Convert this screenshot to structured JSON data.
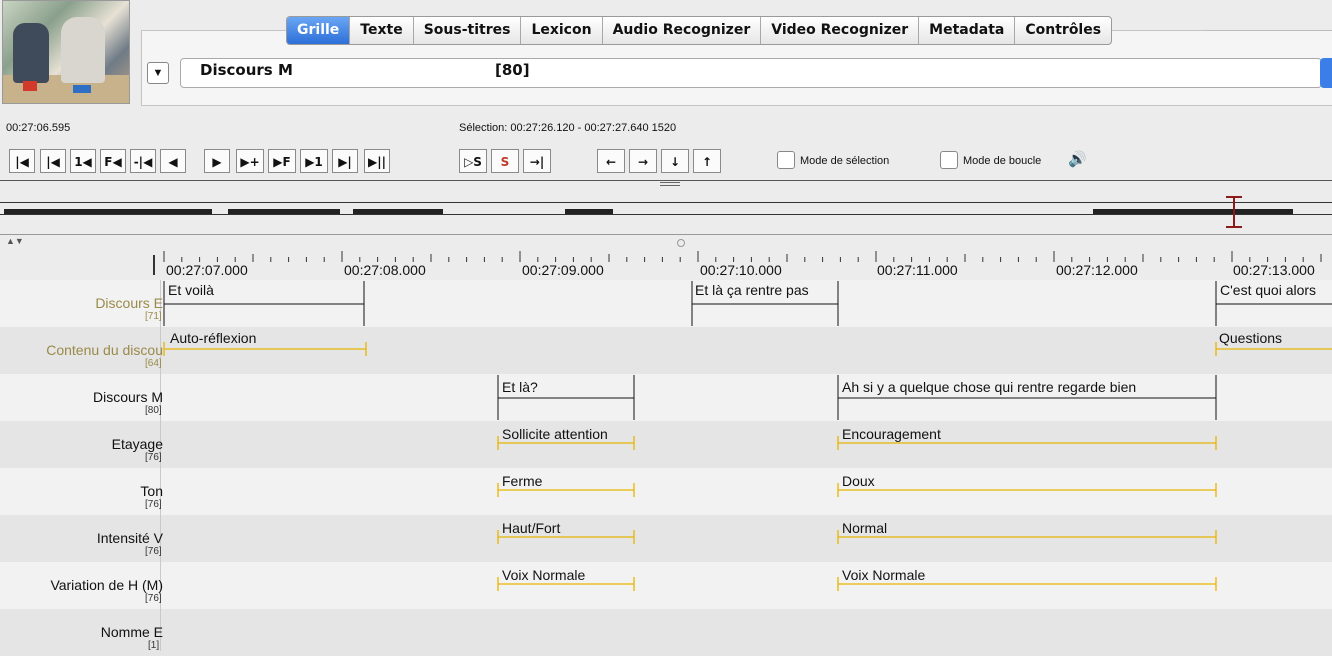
{
  "tabs": [
    "Grille",
    "Texte",
    "Sous-titres",
    "Lexicon",
    "Audio Recognizer",
    "Video Recognizer",
    "Metadata",
    "Contrôles"
  ],
  "active_tab": "Grille",
  "tier_selector": {
    "name": "Discours M",
    "count": "[80]"
  },
  "media_time": "00:27:06.595",
  "selection": "Sélection: 00:27:26.120 - 00:27:27.640  1520",
  "controls": {
    "mode_selection": "Mode de sélection",
    "mode_boucle": "Mode de boucle"
  },
  "ruler_labels": [
    "00:27:07.000",
    "00:27:08.000",
    "00:27:09.000",
    "00:27:10.000",
    "00:27:11.000",
    "00:27:12.000",
    "00:27:13.000"
  ],
  "tiers": [
    {
      "name": "Discours E",
      "count": "[71]"
    },
    {
      "name": "Contenu du discou",
      "count": "[64]"
    },
    {
      "name": "Discours M",
      "count": "[80]"
    },
    {
      "name": "Etayage",
      "count": "[76]"
    },
    {
      "name": "Ton",
      "count": "[76]"
    },
    {
      "name": "Intensité V",
      "count": "[76]"
    },
    {
      "name": "Variation de H (M)",
      "count": "[76]"
    },
    {
      "name": "Nomme E",
      "count": "[1]"
    }
  ],
  "annotations": {
    "a1": "Et voilà",
    "a2": "Et là ça rentre pas",
    "a3": "C'est quoi alors",
    "b1": "Auto-réflexion",
    "b2": "Questions",
    "c1": "Et là?",
    "c2": "Ah si y a quelque chose qui rentre regarde bien",
    "d1": "Sollicite attention",
    "d2": "Encouragement",
    "e1": "Ferme",
    "e2": "Doux",
    "f1": "Haut/Fort",
    "f2": "Normal",
    "g1": "Voix Normale",
    "g2": "Voix Normale"
  },
  "colors": {
    "annotation_gold": "#e8b500",
    "tier_gold": "#9a8a4a",
    "accent_blue": "#2c6fd8",
    "cursor_red": "#8b1b1b"
  },
  "icons": [
    "speaker-icon"
  ]
}
